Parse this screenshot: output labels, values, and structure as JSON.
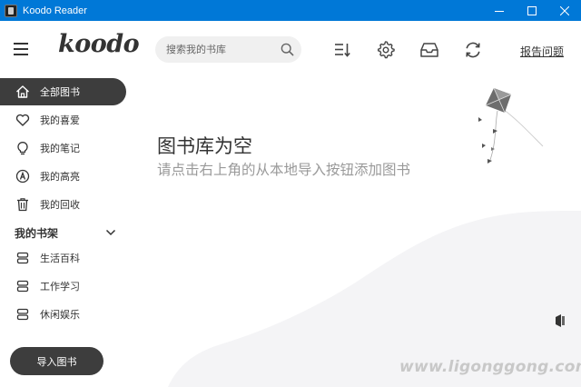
{
  "window": {
    "title": "Koodo Reader",
    "controls": [
      "minimize-icon",
      "maximize-icon",
      "close-icon"
    ]
  },
  "header": {
    "logo": "koodo",
    "search_placeholder": "搜索我的书库",
    "icons": [
      "sort-icon",
      "gear-icon",
      "inbox-icon",
      "sync-icon"
    ],
    "report_label": "报告问题"
  },
  "sidebar": {
    "items": [
      {
        "label": "全部图书",
        "icon": "home-icon",
        "active": true
      },
      {
        "label": "我的喜爱",
        "icon": "heart-icon",
        "active": false
      },
      {
        "label": "我的笔记",
        "icon": "bulb-icon",
        "active": false
      },
      {
        "label": "我的高亮",
        "icon": "highlight-icon",
        "active": false
      },
      {
        "label": "我的回收",
        "icon": "trash-icon",
        "active": false
      }
    ],
    "shelf_title": "我的书架",
    "shelves": [
      {
        "label": "生活百科",
        "icon": "shelf-icon"
      },
      {
        "label": "工作学习",
        "icon": "shelf-icon"
      },
      {
        "label": "休闲娱乐",
        "icon": "shelf-icon"
      }
    ],
    "import_label": "导入图书"
  },
  "main": {
    "empty_title": "图书库为空",
    "empty_desc": "请点击右上角的从本地导入按钮添加图书"
  },
  "watermark": "www.ligonggong.com",
  "colors": {
    "titlebar": "#0078d7",
    "active_item": "#3d3d3d",
    "muted_text": "#999999"
  }
}
